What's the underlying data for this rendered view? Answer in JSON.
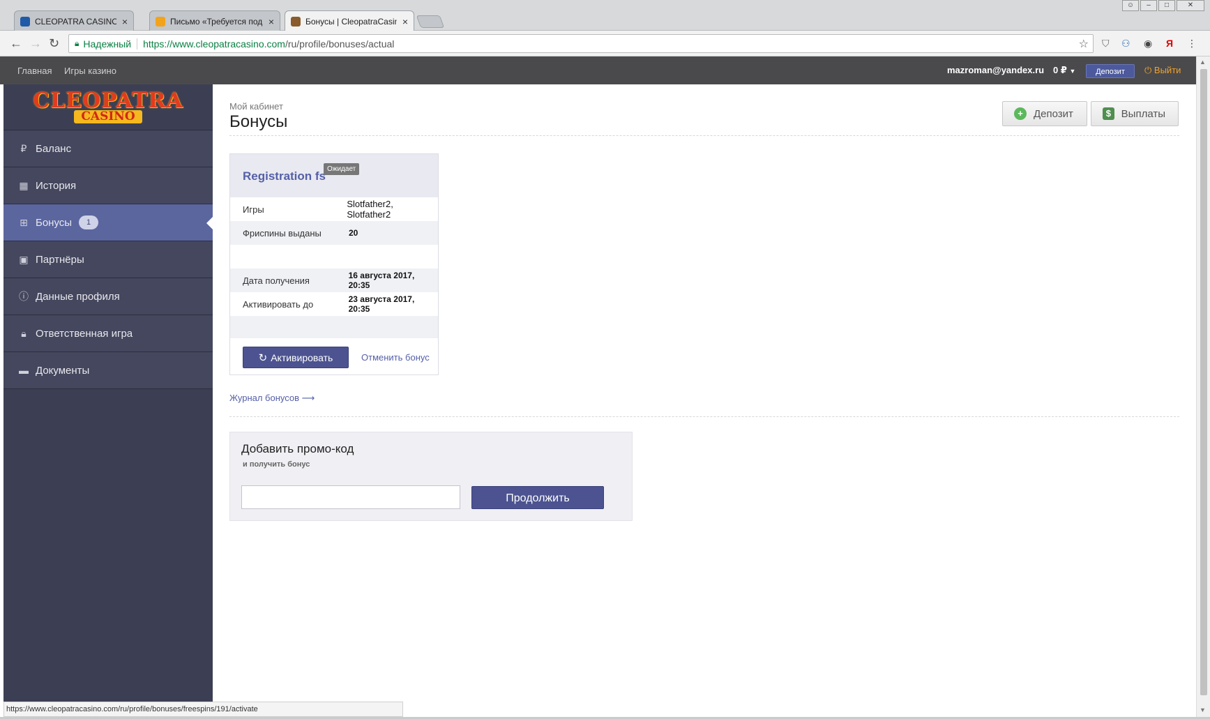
{
  "browser": {
    "tabs": [
      {
        "title": "CLEOPATRA CASINO ОБЗ",
        "favicon_color": "#1f5aa8",
        "close": "×"
      },
      {
        "title": "Письмо «Требуется под",
        "favicon_color": "#f2a31b",
        "close": "×"
      },
      {
        "title": "Бонусы | CleopatraCasin",
        "favicon_color": "#8a5b2c",
        "close": "×"
      }
    ],
    "security_label": "Надежный",
    "url_scheme_host": "https://www.cleopatracasino.com",
    "url_path": "/ru/profile/bonuses/actual",
    "status_url": "https://www.cleopatracasino.com/ru/profile/bonuses/freespins/191/activate"
  },
  "topbar": {
    "nav": [
      "Главная",
      "Игры казино"
    ],
    "email": "mazroman@yandex.ru",
    "balance": "0 ₽",
    "deposit_label": "Депозит",
    "logout_label": "Выйти"
  },
  "logo": {
    "line1": "CLEOPATRA",
    "line2": "CASINO"
  },
  "sidebar": {
    "items": [
      {
        "label": "Баланс",
        "icon": "ruble-icon"
      },
      {
        "label": "История",
        "icon": "calendar-icon"
      },
      {
        "label": "Бонусы",
        "icon": "gift-icon",
        "badge": "1",
        "active": true
      },
      {
        "label": "Партнёры",
        "icon": "briefcase-icon"
      },
      {
        "label": "Данные профиля",
        "icon": "info-icon"
      },
      {
        "label": "Ответственная игра",
        "icon": "lock-icon"
      },
      {
        "label": "Документы",
        "icon": "folder-icon"
      }
    ]
  },
  "page": {
    "breadcrumb": "Мой кабинет",
    "title": "Бонусы",
    "deposit_button": "Депозит",
    "payouts_button": "Выплаты"
  },
  "bonus": {
    "name": "Registration fs",
    "status": "Ожидает",
    "rows": {
      "games_label": "Игры",
      "games_value": "Slotfather2, Slotfather2",
      "freespins_label": "Фриспины выданы",
      "freespins_value": "20",
      "received_label": "Дата получения",
      "received_value": "16 августа 2017, 20:35",
      "activate_until_label": "Активировать до",
      "activate_until_value": "23 августа 2017, 20:35"
    },
    "activate_button": "Активировать",
    "cancel_link": "Отменить бонус"
  },
  "journal_link": "Журнал бонусов",
  "promo": {
    "title": "Добавить промо-код",
    "subtitle": "и получить бонус",
    "input_value": "",
    "continue_button": "Продолжить"
  },
  "colors": {
    "accent": "#4c5390",
    "sidebar": "#3c3f54",
    "link": "#5560a8",
    "logout": "#f0a22a"
  }
}
